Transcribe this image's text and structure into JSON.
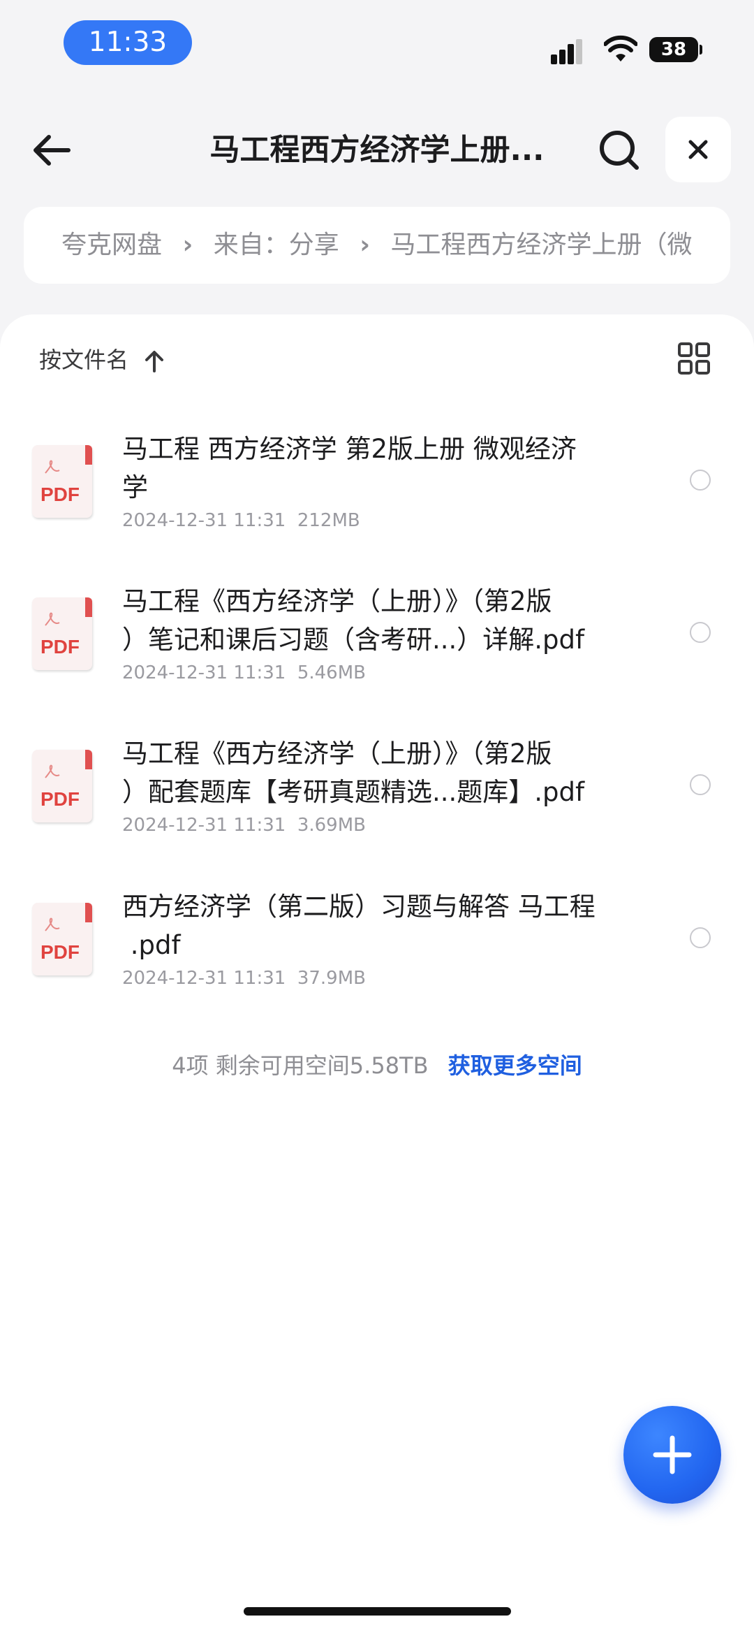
{
  "status_bar": {
    "time": "11:33",
    "battery": "38"
  },
  "header": {
    "title": "马工程西方经济学上册..."
  },
  "breadcrumb": [
    "夸克网盘",
    "来自：分享",
    "马工程西方经济学上册（微"
  ],
  "toolbar": {
    "sort_label": "按文件名"
  },
  "files": [
    {
      "name_lines": [
        "马工程 西方经济学 第2版上册 微观经济",
        "学"
      ],
      "date": "2024-12-31 11:31",
      "size": "212MB",
      "icon_label": "PDF"
    },
    {
      "name_lines": [
        "马工程《西方经济学（上册）》（第2版",
        "）笔记和课后习题（含考研...）详解.pdf"
      ],
      "date": "2024-12-31 11:31",
      "size": "5.46MB",
      "icon_label": "PDF"
    },
    {
      "name_lines": [
        "马工程《西方经济学（上册）》（第2版",
        "）配套题库【考研真题精选...题库】.pdf"
      ],
      "date": "2024-12-31 11:31",
      "size": "3.69MB",
      "icon_label": "PDF"
    },
    {
      "name_lines": [
        "西方经济学（第二版）习题与解答 马工程",
        " .pdf"
      ],
      "date": "2024-12-31 11:31",
      "size": "37.9MB",
      "icon_label": "PDF"
    }
  ],
  "footer": {
    "count": "4项",
    "storage": "剩余可用空间5.58TB",
    "more_space_link": "获取更多空间"
  },
  "colors": {
    "accent": "#3478f6",
    "link": "#1f5fe0",
    "pdf_red": "#e0433f"
  },
  "icons": [
    "back-arrow-icon",
    "search-icon",
    "close-icon",
    "sort-up-arrow-icon",
    "grid-view-icon",
    "pdf-file-icon",
    "plus-icon",
    "wifi-icon",
    "signal-icon"
  ]
}
